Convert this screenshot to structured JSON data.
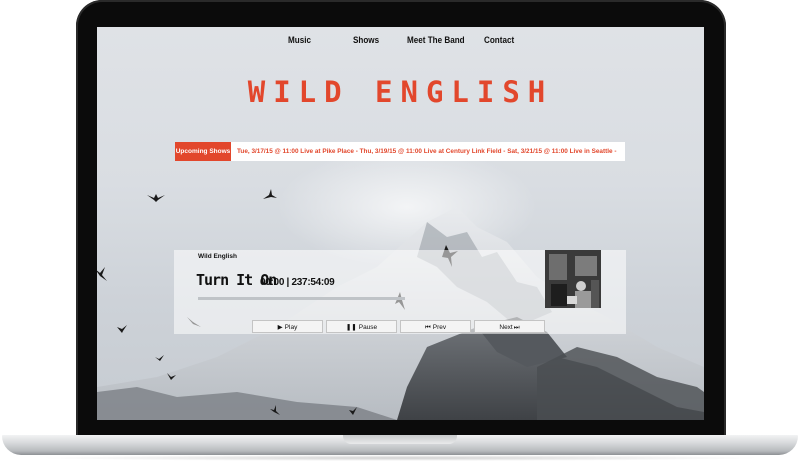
{
  "nav": {
    "items": [
      {
        "label": "Music"
      },
      {
        "label": "Shows"
      },
      {
        "label": "Meet The Band"
      },
      {
        "label": "Contact"
      }
    ]
  },
  "band": {
    "title": "WILD ENGLISH"
  },
  "shows": {
    "label": "Upcoming Shows",
    "ticker": "Tue, 3/17/15 @ 11:00 Live at Pike Place  -   Thu, 3/19/15 @ 11:00 Live at Century Link Field  -   Sat, 3/21/15 @ 11:00 Live in Seattle  -"
  },
  "player": {
    "artist": "Wild English",
    "track": "Turn It On",
    "time": "00:00 | 237:54:09",
    "progress": 0.0,
    "controls": {
      "play": {
        "icon": "play-icon",
        "label": "Play"
      },
      "pause": {
        "icon": "pause-icon",
        "label": "Pause"
      },
      "prev": {
        "icon": "prev-icon",
        "label": "Prev"
      },
      "next": {
        "icon": "next-icon",
        "label": "Next"
      }
    }
  },
  "colors": {
    "accent": "#e2472c",
    "text": "#111111"
  }
}
